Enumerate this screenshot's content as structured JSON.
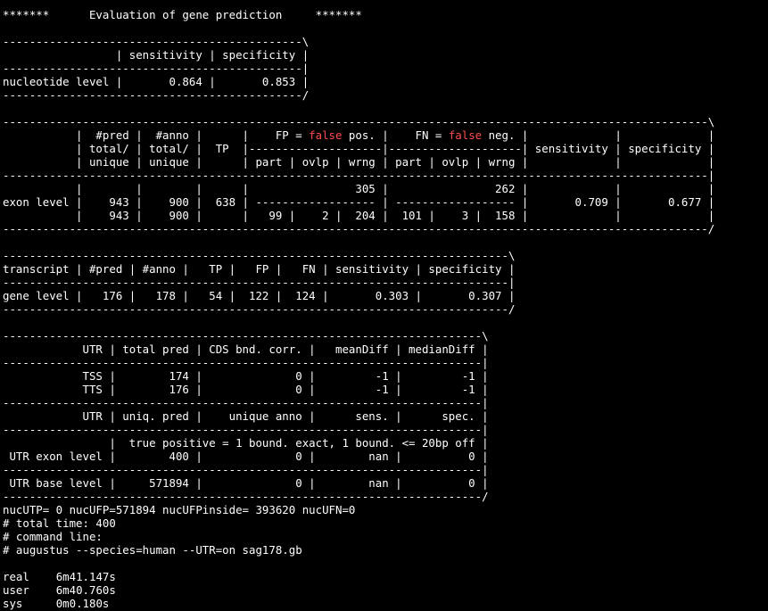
{
  "terminal": {
    "background": "#000000",
    "foreground": "#ffffff",
    "highlight_color": "#ff4d4d",
    "lines": [
      [
        {
          "t": "*******      Evaluation of gene prediction     *******"
        }
      ],
      [
        {
          "t": ""
        }
      ],
      [
        {
          "t": "---------------------------------------------\\"
        }
      ],
      [
        {
          "t": "                 | sensitivity | specificity |"
        }
      ],
      [
        {
          "t": "---------------------------------------------|"
        }
      ],
      [
        {
          "t": "nucleotide level |       0.864 |       0.853 |"
        }
      ],
      [
        {
          "t": "---------------------------------------------/"
        }
      ],
      [
        {
          "t": ""
        }
      ],
      [
        {
          "t": "----------------------------------------------------------------------------------------------------------\\"
        }
      ],
      [
        {
          "t": "           |  #pred |  #anno |      |    FP = "
        },
        {
          "t": "false",
          "c": "red"
        },
        {
          "t": " pos. |    FN = "
        },
        {
          "t": "false",
          "c": "red"
        },
        {
          "t": " neg. |             |             |"
        }
      ],
      [
        {
          "t": "           | total/ | total/ |  TP  |--------------------|--------------------| sensitivity | specificity |"
        }
      ],
      [
        {
          "t": "           | unique | unique |      | part | ovlp | wrng | part | ovlp | wrng |             |             |"
        }
      ],
      [
        {
          "t": "----------------------------------------------------------------------------------------------------------|"
        }
      ],
      [
        {
          "t": "           |        |        |      |                305 |                262 |             |             |"
        }
      ],
      [
        {
          "t": "exon level |    943 |    900 |  638 | ------------------ | ------------------ |       0.709 |       0.677 |"
        }
      ],
      [
        {
          "t": "           |    943 |    900 |      |   99 |    2 |  204 |  101 |    3 |  158 |             |             |"
        }
      ],
      [
        {
          "t": "----------------------------------------------------------------------------------------------------------/"
        }
      ],
      [
        {
          "t": ""
        }
      ],
      [
        {
          "t": "----------------------------------------------------------------------------\\"
        }
      ],
      [
        {
          "t": "transcript | #pred | #anno |   TP |   FP |   FN | sensitivity | specificity |"
        }
      ],
      [
        {
          "t": "----------------------------------------------------------------------------|"
        }
      ],
      [
        {
          "t": "gene level |   176 |   178 |   54 |  122 |  124 |       0.303 |       0.307 |"
        }
      ],
      [
        {
          "t": "----------------------------------------------------------------------------/"
        }
      ],
      [
        {
          "t": ""
        }
      ],
      [
        {
          "t": "------------------------------------------------------------------------\\"
        }
      ],
      [
        {
          "t": "            UTR | total pred | CDS bnd. corr. |   meanDiff | medianDiff |"
        }
      ],
      [
        {
          "t": "------------------------------------------------------------------------|"
        }
      ],
      [
        {
          "t": "            TSS |        174 |              0 |         -1 |         -1 |"
        }
      ],
      [
        {
          "t": "            TTS |        176 |              0 |         -1 |         -1 |"
        }
      ],
      [
        {
          "t": "------------------------------------------------------------------------|"
        }
      ],
      [
        {
          "t": "            UTR | uniq. pred |    unique anno |      sens. |      spec. |"
        }
      ],
      [
        {
          "t": "------------------------------------------------------------------------|"
        }
      ],
      [
        {
          "t": "                |  true positive = 1 bound. exact, 1 bound. <= 20bp off |"
        }
      ],
      [
        {
          "t": " UTR exon level |        400 |              0 |        nan |          0 |"
        }
      ],
      [
        {
          "t": "------------------------------------------------------------------------|"
        }
      ],
      [
        {
          "t": " UTR base level |     571894 |              0 |        nan |          0 |"
        }
      ],
      [
        {
          "t": "------------------------------------------------------------------------/"
        }
      ],
      [
        {
          "t": "nucUTP= 0 nucUFP=571894 nucUFPinside= 393620 nucUFN=0"
        }
      ],
      [
        {
          "t": "# total time: 400"
        }
      ],
      [
        {
          "t": "# command line:"
        }
      ],
      [
        {
          "t": "# augustus --species=human --UTR=on sag178.gb"
        }
      ],
      [
        {
          "t": ""
        }
      ],
      [
        {
          "t": "real\t6m41.147s"
        }
      ],
      [
        {
          "t": "user\t6m40.760s"
        }
      ],
      [
        {
          "t": "sys\t0m0.180s"
        }
      ]
    ]
  }
}
